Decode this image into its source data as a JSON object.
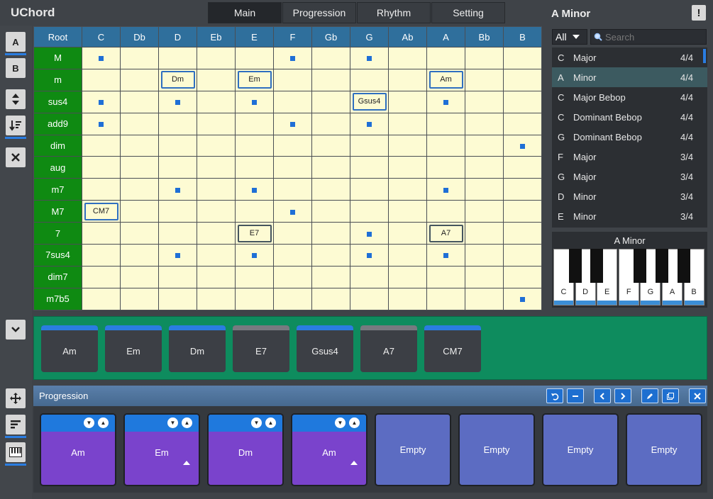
{
  "app": {
    "title": "UChord"
  },
  "tabs": [
    {
      "label": "Main",
      "active": true
    },
    {
      "label": "Progression",
      "active": false
    },
    {
      "label": "Rhythm",
      "active": false
    },
    {
      "label": "Setting",
      "active": false
    }
  ],
  "current_scale": "A Minor",
  "alert_label": "!",
  "left_toolbar": {
    "a_label": "A",
    "b_label": "B"
  },
  "grid": {
    "corner": "Root",
    "roots": [
      "C",
      "Db",
      "D",
      "Eb",
      "E",
      "F",
      "Gb",
      "G",
      "Ab",
      "A",
      "Bb",
      "B"
    ],
    "rows": [
      {
        "label": "M",
        "cells": [
          "dot",
          "",
          "",
          "",
          "",
          "dot",
          "",
          "dot",
          "",
          "",
          "",
          ""
        ]
      },
      {
        "label": "m",
        "cells": [
          "",
          "",
          "chip:Dm",
          "",
          "chip:Em",
          "",
          "",
          "",
          "",
          "chip:Am",
          "",
          ""
        ]
      },
      {
        "label": "sus4",
        "cells": [
          "dot",
          "",
          "dot",
          "",
          "dot",
          "",
          "",
          "chip:Gsus4",
          "",
          "dot",
          "",
          ""
        ]
      },
      {
        "label": "add9",
        "cells": [
          "dot",
          "",
          "",
          "",
          "",
          "dot",
          "",
          "dot",
          "",
          "",
          "",
          ""
        ]
      },
      {
        "label": "dim",
        "cells": [
          "",
          "",
          "",
          "",
          "",
          "",
          "",
          "",
          "",
          "",
          "",
          "dot"
        ]
      },
      {
        "label": "aug",
        "cells": [
          "",
          "",
          "",
          "",
          "",
          "",
          "",
          "",
          "",
          "",
          "",
          ""
        ]
      },
      {
        "label": "m7",
        "cells": [
          "",
          "",
          "dot",
          "",
          "dot",
          "",
          "",
          "",
          "",
          "dot",
          "",
          ""
        ]
      },
      {
        "label": "M7",
        "cells": [
          "chip:CM7",
          "",
          "",
          "",
          "",
          "dot",
          "",
          "",
          "",
          "",
          "",
          ""
        ]
      },
      {
        "label": "7",
        "cells": [
          "",
          "",
          "",
          "",
          "darkchip:E7",
          "",
          "",
          "dot",
          "",
          "darkchip:A7",
          "",
          ""
        ]
      },
      {
        "label": "7sus4",
        "cells": [
          "",
          "",
          "dot",
          "",
          "dot",
          "",
          "",
          "dot",
          "",
          "dot",
          "",
          ""
        ]
      },
      {
        "label": "dim7",
        "cells": [
          "",
          "",
          "",
          "",
          "",
          "",
          "",
          "",
          "",
          "",
          "",
          ""
        ]
      },
      {
        "label": "m7b5",
        "cells": [
          "",
          "",
          "",
          "",
          "",
          "",
          "",
          "",
          "",
          "",
          "",
          "dot"
        ]
      }
    ]
  },
  "scale_filter": {
    "value": "All",
    "search_placeholder": "Search"
  },
  "scale_list": [
    {
      "root": "C",
      "name": "Major",
      "meter": "4/4"
    },
    {
      "root": "A",
      "name": "Minor",
      "meter": "4/4",
      "selected": true
    },
    {
      "root": "C",
      "name": "Major Bebop",
      "meter": "4/4"
    },
    {
      "root": "C",
      "name": "Dominant Bebop",
      "meter": "4/4"
    },
    {
      "root": "G",
      "name": "Dominant Bebop",
      "meter": "4/4"
    },
    {
      "root": "F",
      "name": "Major",
      "meter": "3/4"
    },
    {
      "root": "G",
      "name": "Major",
      "meter": "3/4"
    },
    {
      "root": "D",
      "name": "Minor",
      "meter": "3/4"
    },
    {
      "root": "E",
      "name": "Minor",
      "meter": "3/4"
    }
  ],
  "piano": {
    "title": "A Minor",
    "keys": [
      "C",
      "D",
      "E",
      "F",
      "G",
      "A",
      "B"
    ]
  },
  "palette": [
    {
      "label": "Am",
      "accent": "blue"
    },
    {
      "label": "Em",
      "accent": "blue"
    },
    {
      "label": "Dm",
      "accent": "blue"
    },
    {
      "label": "E7",
      "accent": "grey"
    },
    {
      "label": "Gsus4",
      "accent": "blue"
    },
    {
      "label": "A7",
      "accent": "grey"
    },
    {
      "label": "CM7",
      "accent": "blue"
    }
  ],
  "progression": {
    "title": "Progression",
    "slots": [
      {
        "label": "Am",
        "filled": true,
        "marker": false
      },
      {
        "label": "Em",
        "filled": true,
        "marker": true
      },
      {
        "label": "Dm",
        "filled": true,
        "marker": false
      },
      {
        "label": "Am",
        "filled": true,
        "marker": true
      },
      {
        "label": "Empty",
        "filled": false
      },
      {
        "label": "Empty",
        "filled": false
      },
      {
        "label": "Empty",
        "filled": false
      },
      {
        "label": "Empty",
        "filled": false
      }
    ]
  },
  "colors": {
    "accent": "#2a7de1",
    "grid_row_header": "#0f8a12",
    "grid_col_header": "#2f6f9c",
    "palette_bg": "#0e8c5e",
    "slot_filled": "#7a43cc",
    "slot_empty": "#5c6cc2"
  }
}
